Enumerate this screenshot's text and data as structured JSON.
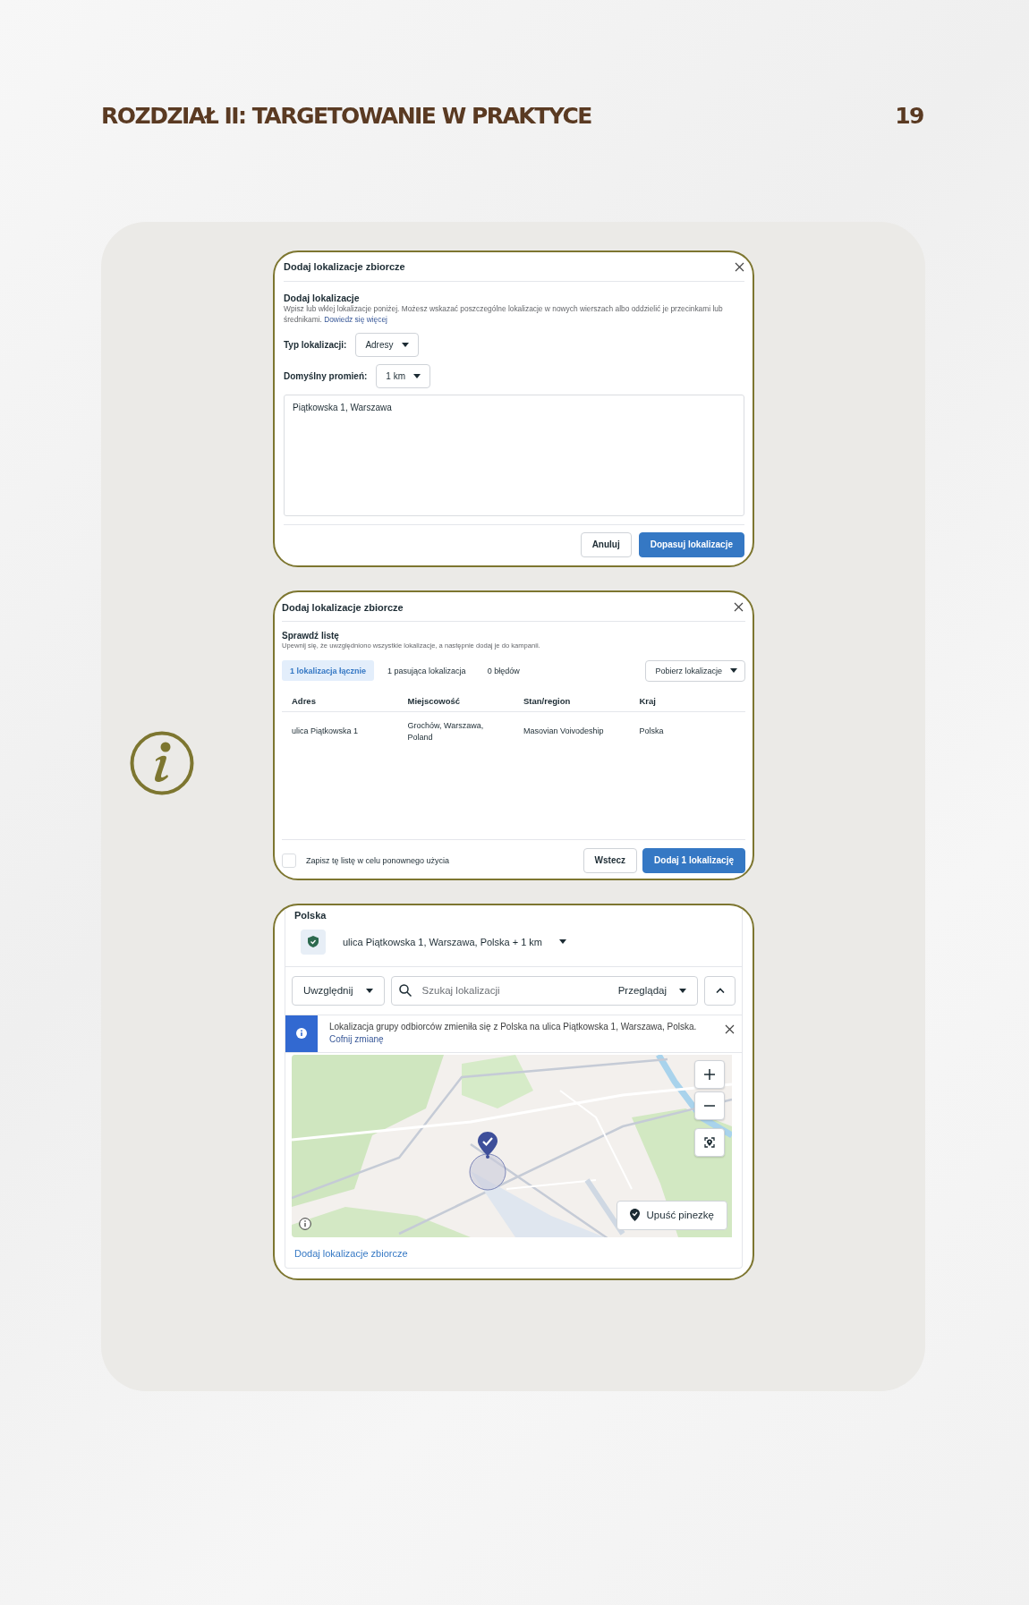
{
  "header": {
    "title": "ROZDZIAŁ II: TARGETOWANIE W PRAKTYCE",
    "page_number": "19"
  },
  "bulk_dialog": {
    "title": "Dodaj lokalizacje zbiorcze",
    "section_title": "Dodaj lokalizacje",
    "description": "Wpisz lub wklej lokalizacje poniżej. Możesz wskazać poszczególne lokalizacje w nowych wierszach albo oddzielić je przecinkami lub średnikami.",
    "link": "Dowiedz się więcej",
    "fields": [
      {
        "label": "Typ lokalizacji:",
        "value": "Adresy"
      },
      {
        "label": "Domyślny promień:",
        "value": "1 km"
      }
    ],
    "input_text": "Piątkowska 1, Warszawa",
    "buttons": [
      {
        "label": "Anuluj",
        "kind": "secondary"
      },
      {
        "label": "Dopasuj lokalizacje",
        "kind": "primary"
      }
    ]
  },
  "review_dialog": {
    "title": "Dodaj lokalizacje zbiorcze",
    "section_title": "Sprawdź listę",
    "description": "Upewnij się, że uwzględniono wszystkie lokalizacje, a następnie dodaj je do kampanii.",
    "tabs": [
      {
        "label": "1 lokalizacja łącznie",
        "selected": true
      },
      {
        "label": "1 pasująca lokalizacja",
        "selected": false
      },
      {
        "label": "0 błędów",
        "selected": false
      }
    ],
    "download_button": "Pobierz lokalizacje",
    "columns": [
      "Adres",
      "Miejscowość",
      "Stan/region",
      "Kraj"
    ],
    "rows": [
      [
        "ulica Piątkowska 1",
        "Grochów, Warszawa, Poland",
        "Masovian Voivodeship",
        "Polska"
      ]
    ],
    "save_checkbox": {
      "label": "Zapisz tę listę w celu ponownego użycia",
      "checked": false
    },
    "buttons": [
      {
        "label": "Wstecz",
        "kind": "secondary"
      },
      {
        "label": "Dodaj 1 lokalizację",
        "kind": "primary"
      }
    ]
  },
  "location_panel": {
    "country": "Polska",
    "location": "ulica Piątkowska 1, Warszawa, Polska + 1 km",
    "include_dropdown": "Uwzględnij",
    "search": {
      "placeholder": "Szukaj lokalizacji"
    },
    "browse_dropdown": "Przeglądaj",
    "notice": {
      "text": "Lokalizacja grupy odbiorców zmieniła się z Polska na ulica Piątkowska 1, Warszawa, Polska.",
      "link": "Cofnij zmianę"
    },
    "drop_pin_button": "Upuść pinezkę",
    "footer_link": "Dodaj lokalizacje zbiorcze"
  }
}
